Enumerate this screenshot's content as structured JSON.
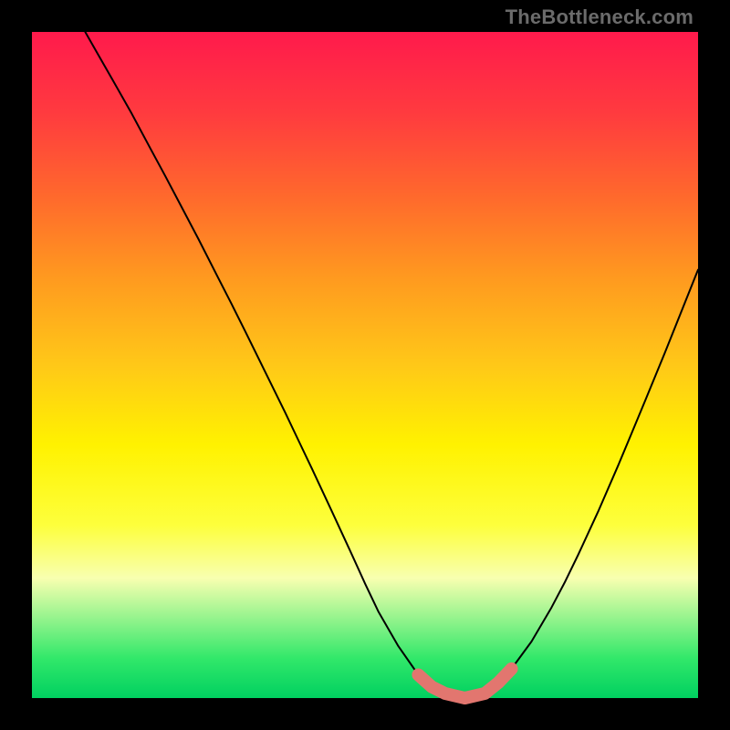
{
  "watermark": "TheBottleneck.com",
  "colors": {
    "background": "#000000",
    "curve_thin": "#000000",
    "curve_fat": "#e2766f",
    "gradient_stops": [
      "#ff1a4c",
      "#ff3a3f",
      "#ff6a2c",
      "#ff9a1f",
      "#ffc818",
      "#fff200",
      "#fdff3c",
      "#f8ffb0",
      "#32e86a",
      "#00d060"
    ]
  },
  "chart_data": {
    "type": "line",
    "title": "",
    "xlabel": "",
    "ylabel": "",
    "xlim": [
      0,
      100
    ],
    "ylim": [
      0,
      100
    ],
    "series": [
      {
        "name": "curve",
        "x": [
          8,
          10,
          12,
          15,
          18,
          20,
          22,
          25,
          28,
          30,
          32,
          35,
          38,
          40,
          42,
          45,
          48,
          50,
          52,
          55,
          58,
          60,
          62,
          65,
          68,
          70,
          72,
          75,
          78,
          80,
          82,
          85,
          88,
          90,
          92,
          95,
          98,
          100
        ],
        "y": [
          100,
          96.5,
          93,
          87.7,
          82.1,
          78.4,
          74.6,
          68.9,
          63,
          59.1,
          55.1,
          49,
          42.9,
          38.7,
          34.5,
          28.1,
          21.6,
          17.2,
          13,
          7.8,
          3.5,
          1.7,
          0.7,
          0,
          0.7,
          2.3,
          4.4,
          8.5,
          13.6,
          17.4,
          21.5,
          28,
          34.9,
          39.7,
          44.5,
          51.8,
          59.3,
          64.3
        ]
      }
    ],
    "highlight_range": {
      "x_start": 58,
      "x_end": 72
    }
  }
}
